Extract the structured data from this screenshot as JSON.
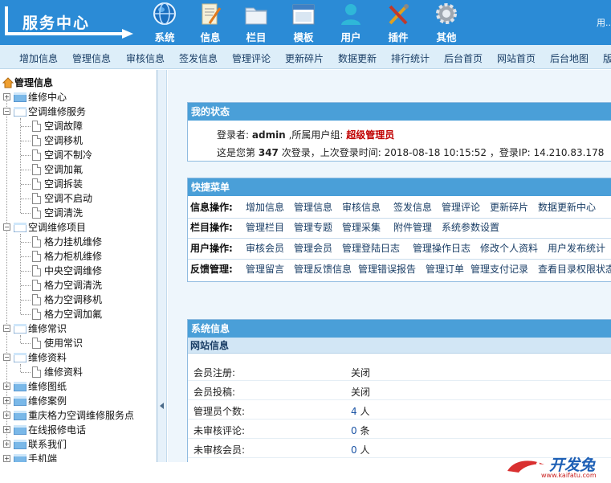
{
  "header": {
    "brand": "服务中心",
    "user_link": "用..",
    "nav": [
      {
        "label": "系统",
        "icon": "globe-icon"
      },
      {
        "label": "信息",
        "icon": "document-pen-icon"
      },
      {
        "label": "栏目",
        "icon": "folder-icon"
      },
      {
        "label": "模板",
        "icon": "window-template-icon"
      },
      {
        "label": "用户",
        "icon": "user-icon"
      },
      {
        "label": "插件",
        "icon": "tools-icon"
      },
      {
        "label": "其他",
        "icon": "gear-icon"
      }
    ]
  },
  "menubar": [
    "增加信息",
    "管理信息",
    "审核信息",
    "签发信息",
    "管理评论",
    "更新碎片",
    "数据更新",
    "排行统计",
    "后台首页",
    "网站首页",
    "后台地图",
    "版"
  ],
  "tree": {
    "root": "管理信息",
    "nodes": [
      {
        "label": "维修中心",
        "children": []
      },
      {
        "label": "空调维修服务",
        "children": [
          "空调故障",
          "空调移机",
          "空调不制冷",
          "空调加氟",
          "空调拆装",
          "空调不启动",
          "空调清洗"
        ]
      },
      {
        "label": "空调维修项目",
        "children": [
          "格力挂机维修",
          "格力柜机维修",
          "中央空调维修",
          "格力空调清洗",
          "格力空调移机",
          "格力空调加氟"
        ]
      },
      {
        "label": "维修常识",
        "children": [
          "使用常识"
        ]
      },
      {
        "label": "维修资料",
        "children": [
          "维修资料"
        ]
      },
      {
        "label": "维修图纸",
        "children": []
      },
      {
        "label": "维修案例",
        "children": []
      },
      {
        "label": "重庆格力空调维修服务点",
        "children": []
      },
      {
        "label": "在线报修电话",
        "children": []
      },
      {
        "label": "联系我们",
        "children": []
      },
      {
        "label": "手机端",
        "children": []
      }
    ]
  },
  "status": {
    "title": "我的状态",
    "login_prefix": "登录者:",
    "username": "admin",
    "group_prefix": ",所属用户组:",
    "group": "超级管理员",
    "count_prefix": "这是您第",
    "login_count": "347",
    "count_suffix": "次登录，上次登录时间:",
    "last_time": "2018-08-18 10:15:52",
    "ip_prefix": "，登录IP:",
    "ip": "14.210.83.178"
  },
  "quickmenu": {
    "title": "快捷菜单",
    "rows": [
      {
        "label": "信息操作:",
        "links": [
          "增加信息",
          "管理信息",
          "审核信息",
          "签发信息",
          "管理评论",
          "更新碎片",
          "数据更新中心"
        ]
      },
      {
        "label": "栏目操作:",
        "links": [
          "管理栏目",
          "管理专题",
          "管理采集",
          "附件管理",
          "系统参数设置"
        ]
      },
      {
        "label": "用户操作:",
        "links": [
          "审核会员",
          "管理会员",
          "管理登陆日志",
          "管理操作日志",
          "修改个人资料",
          "用户发布统计"
        ]
      },
      {
        "label": "反馈管理:",
        "links": [
          "管理留言",
          "管理反馈信息",
          "管理错误报告",
          "管理订单",
          "管理支付记录",
          "查看目录权限状态"
        ]
      }
    ]
  },
  "sysinfo": {
    "title": "系统信息",
    "subtitle": "网站信息",
    "rows": [
      {
        "key": "会员注册:",
        "value": "关闭",
        "num": false
      },
      {
        "key": "会员投稿:",
        "value": "关闭",
        "num": false
      },
      {
        "key": "管理员个数:",
        "value": "4",
        "unit": "人",
        "num": true
      },
      {
        "key": "未审核评论:",
        "value": "0",
        "unit": "条",
        "num": true
      },
      {
        "key": "未审核会员:",
        "value": "0",
        "unit": "人",
        "num": true
      }
    ]
  },
  "watermark": {
    "text": "开发兔",
    "url": "www.kaifatu.com"
  }
}
